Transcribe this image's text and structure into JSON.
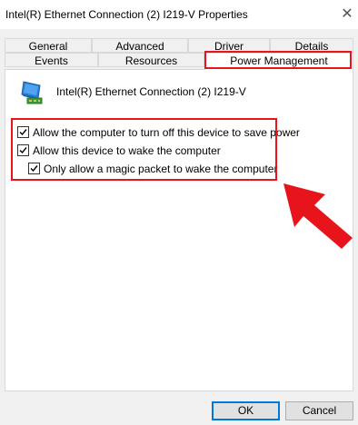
{
  "window": {
    "title": "Intel(R) Ethernet Connection (2) I219-V Properties",
    "close_icon": "close-icon"
  },
  "tabs_row1": [
    "General",
    "Advanced",
    "Driver",
    "Details"
  ],
  "tabs_row2": [
    "Events",
    "Resources",
    "Power Management"
  ],
  "active_tab": "Power Management",
  "device": {
    "name": "Intel(R) Ethernet Connection (2) I219-V",
    "icon": "network-adapter-icon"
  },
  "options": [
    {
      "label": "Allow the computer to turn off this device to save power",
      "checked": true
    },
    {
      "label": "Allow this device to wake the computer",
      "checked": true
    },
    {
      "label": "Only allow a magic packet to wake the computer",
      "checked": true
    }
  ],
  "buttons": {
    "ok": "OK",
    "cancel": "Cancel"
  },
  "highlight_color": "#e8141c"
}
